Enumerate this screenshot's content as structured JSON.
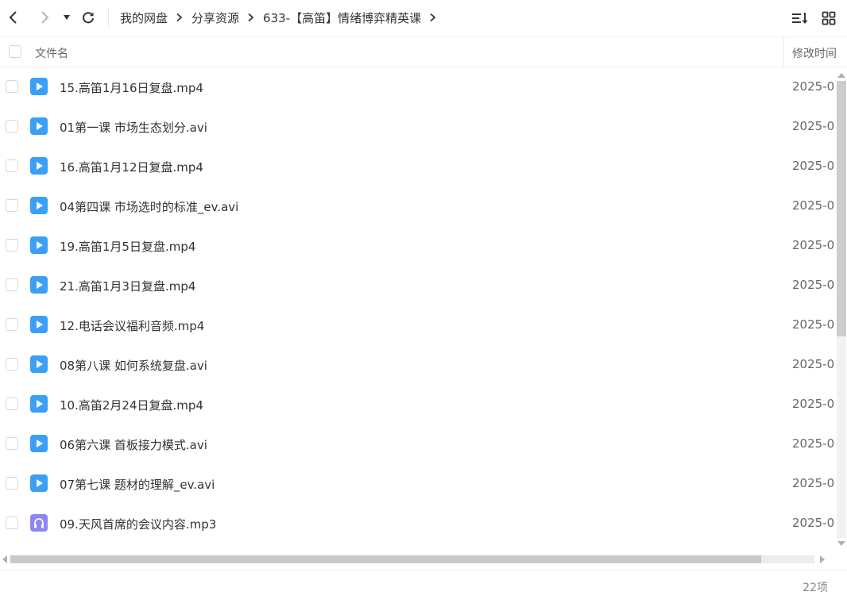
{
  "icons": {
    "back": "chevron-left-icon",
    "forward": "chevron-right-icon",
    "dropdown": "caret-down-icon",
    "refresh": "refresh-icon",
    "crumb_separator": "chevron-right-icon",
    "sort": "sort-list-icon",
    "grid_view": "grid-view-icon",
    "video": "video-file-icon",
    "audio": "audio-file-icon"
  },
  "colors": {
    "video_icon": "#3aa0f7",
    "audio_icon": "#8f86f5",
    "nav_disabled": "#b8b8b8"
  },
  "breadcrumb": [
    "我的网盘",
    "分享资源",
    "633-【高笛】情绪博弈精英课"
  ],
  "header": {
    "name_label": "文件名",
    "time_label": "修改时间"
  },
  "files": [
    {
      "name": "15.高笛1月16日复盘.mp4",
      "time": "2025-0",
      "type": "video"
    },
    {
      "name": "01第一课 市场生态划分.avi",
      "time": "2025-0",
      "type": "video"
    },
    {
      "name": "16.高笛1月12日复盘.mp4",
      "time": "2025-0",
      "type": "video"
    },
    {
      "name": "04第四课 市场选时的标准_ev.avi",
      "time": "2025-0",
      "type": "video"
    },
    {
      "name": "19.高笛1月5日复盘.mp4",
      "time": "2025-0",
      "type": "video"
    },
    {
      "name": "21.高笛1月3日复盘.mp4",
      "time": "2025-0",
      "type": "video"
    },
    {
      "name": "12.电话会议福利音频.mp4",
      "time": "2025-0",
      "type": "video"
    },
    {
      "name": "08第八课 如何系统复盘.avi",
      "time": "2025-0",
      "type": "video"
    },
    {
      "name": "10.高笛2月24日复盘.mp4",
      "time": "2025-0",
      "type": "video"
    },
    {
      "name": "06第六课 首板接力模式.avi",
      "time": "2025-0",
      "type": "video"
    },
    {
      "name": "07第七课 题材的理解_ev.avi",
      "time": "2025-0",
      "type": "video"
    },
    {
      "name": "09.天风首席的会议内容.mp3",
      "time": "2025-0",
      "type": "audio"
    }
  ],
  "status": {
    "item_count": "22项"
  }
}
